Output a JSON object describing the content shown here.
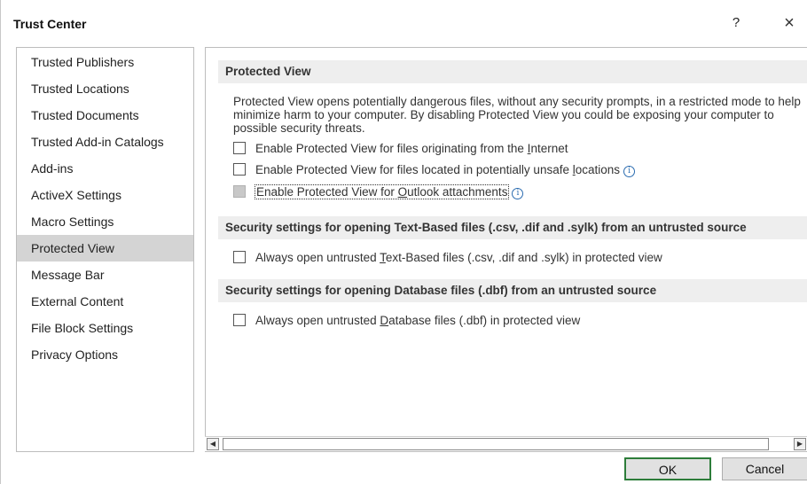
{
  "window": {
    "title": "Trust Center",
    "help_glyph": "?",
    "close_glyph": "×"
  },
  "sidebar": {
    "items": [
      {
        "label": "Trusted Publishers",
        "selected": false
      },
      {
        "label": "Trusted Locations",
        "selected": false
      },
      {
        "label": "Trusted Documents",
        "selected": false
      },
      {
        "label": "Trusted Add-in Catalogs",
        "selected": false
      },
      {
        "label": "Add-ins",
        "selected": false
      },
      {
        "label": "ActiveX Settings",
        "selected": false
      },
      {
        "label": "Macro Settings",
        "selected": false
      },
      {
        "label": "Protected View",
        "selected": true
      },
      {
        "label": "Message Bar",
        "selected": false
      },
      {
        "label": "External Content",
        "selected": false
      },
      {
        "label": "File Block Settings",
        "selected": false
      },
      {
        "label": "Privacy Options",
        "selected": false
      }
    ]
  },
  "protected_view": {
    "header": "Protected View",
    "description": "Protected View opens potentially dangerous files, without any security prompts, in a restricted mode to help minimize harm to your computer. By disabling Protected View you could be exposing your computer to possible security threats.",
    "options": [
      {
        "pre": "Enable Protected View for files originating from the ",
        "key": "I",
        "post": "nternet",
        "checked": false,
        "disabled": false,
        "info": false
      },
      {
        "pre": "Enable Protected View for files located in potentially unsafe ",
        "key": "l",
        "post": "ocations",
        "checked": false,
        "disabled": false,
        "info": true
      },
      {
        "pre": "Enable Protected View for ",
        "key": "O",
        "post": "utlook attachments",
        "checked": false,
        "disabled": true,
        "info": true
      }
    ]
  },
  "text_based": {
    "header": "Security settings for opening Text-Based files (.csv, .dif and .sylk) from an untrusted source",
    "option": {
      "pre": "Always open untrusted ",
      "key": "T",
      "post": "ext-Based files (.csv, .dif and .sylk) in protected view",
      "checked": false
    }
  },
  "database": {
    "header": "Security settings for opening Database files (.dbf) from an untrusted source",
    "option": {
      "pre": "Always open untrusted ",
      "key": "D",
      "post": "atabase files (.dbf) in protected view",
      "checked": false
    }
  },
  "scrollbar": {
    "left_arrow": "◀",
    "right_arrow": "▶"
  },
  "buttons": {
    "ok": "OK",
    "cancel": "Cancel"
  },
  "info_glyph": "i",
  "colors": {
    "selected_bg": "#d4d4d4",
    "section_bg": "#eeeeee",
    "ok_border": "#2d7d3a",
    "info_blue": "#2b6cb0"
  }
}
